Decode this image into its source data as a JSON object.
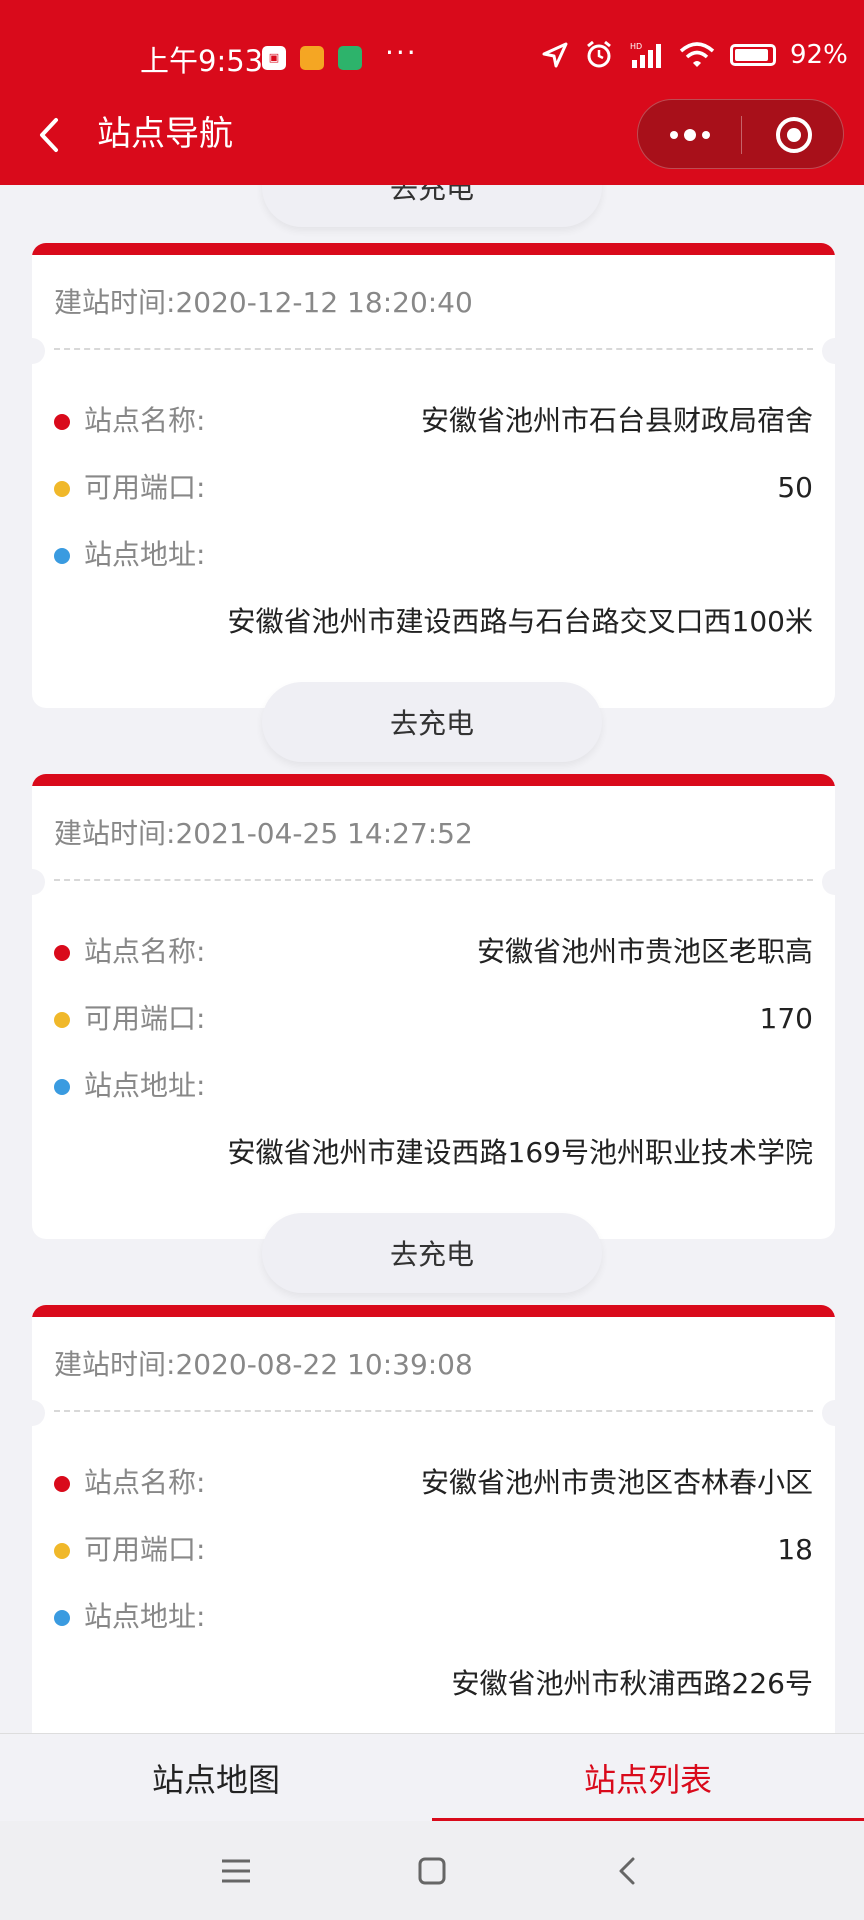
{
  "status_bar": {
    "time": "上午9:53",
    "battery": "92%",
    "more_dots": "···"
  },
  "nav": {
    "title": "站点导航"
  },
  "labels": {
    "build_time": "建站时间:",
    "station_name": "站点名称:",
    "ports": "可用端口:",
    "address": "站点地址:",
    "go_charge": "去充电"
  },
  "colors": {
    "brand_red": "#d90a1b",
    "dot_name": "#d90a1b",
    "dot_ports": "#f0b82a",
    "dot_address": "#3a9be0"
  },
  "stations": [
    {
      "build_time": "2020-12-12 18:20:40",
      "name": "安徽省池州市石台县财政局宿舍",
      "ports": "50",
      "address": "安徽省池州市建设西路与石台路交叉口西100米"
    },
    {
      "build_time": "2021-04-25 14:27:52",
      "name": "安徽省池州市贵池区老职高",
      "ports": "170",
      "address": "安徽省池州市建设西路169号池州职业技术学院"
    },
    {
      "build_time": "2020-08-22 10:39:08",
      "name": "安徽省池州市贵池区杏林春小区",
      "ports": "18",
      "address": "安徽省池州市秋浦西路226号"
    }
  ],
  "tabs": {
    "map": "站点地图",
    "list": "站点列表"
  }
}
